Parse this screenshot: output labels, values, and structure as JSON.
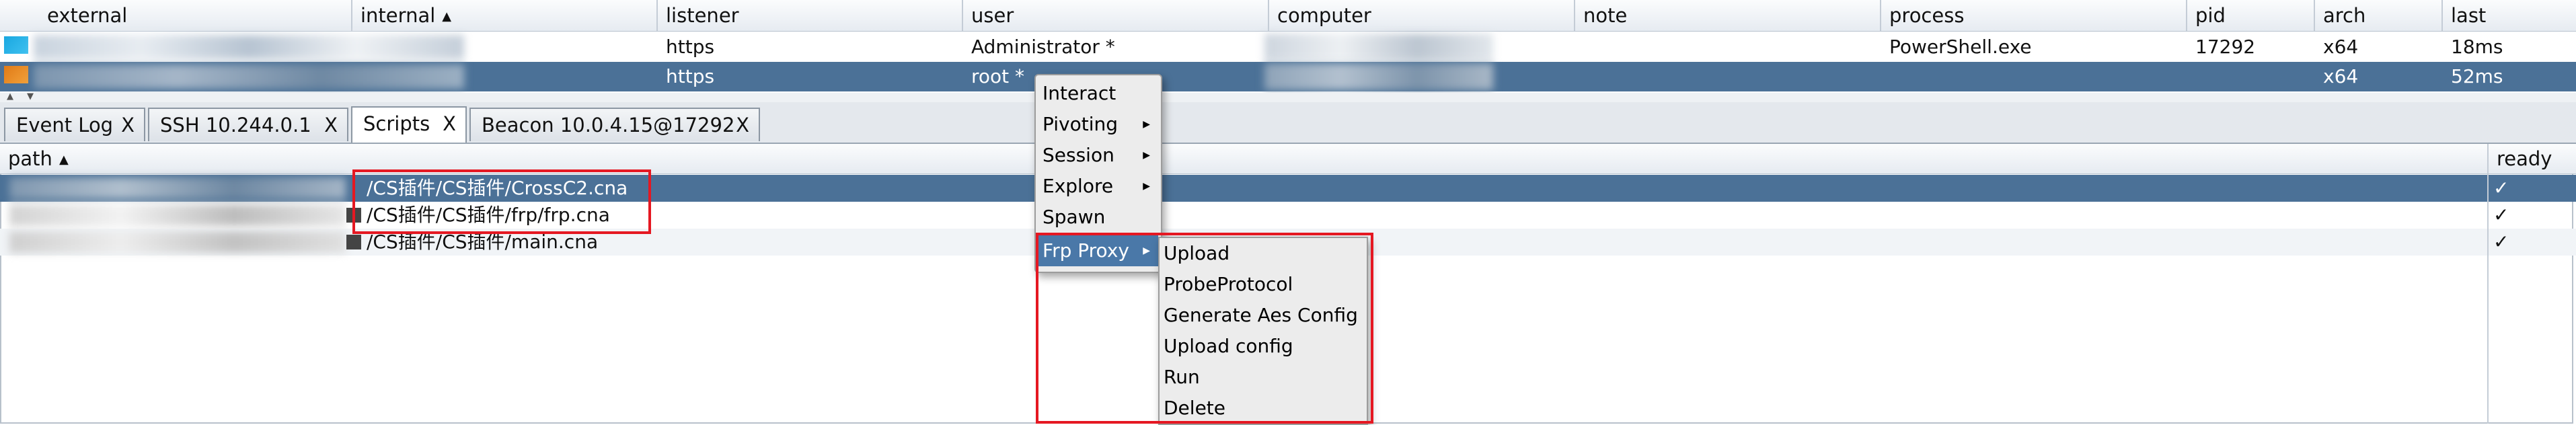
{
  "sessions": {
    "columns": [
      "external",
      "internal",
      "listener",
      "user",
      "computer",
      "note",
      "process",
      "pid",
      "arch",
      "last"
    ],
    "rows": [
      {
        "listener": "https",
        "user": "Administrator *",
        "process": "PowerShell.exe",
        "pid": "17292",
        "arch": "x64",
        "last": "18ms"
      },
      {
        "listener": "https",
        "user": "root *",
        "process": "",
        "pid": "",
        "arch": "x64",
        "last": "52ms"
      }
    ]
  },
  "tabs": [
    {
      "label": "Event Log",
      "close": "X"
    },
    {
      "label": "SSH 10.244.0.1",
      "close": "X"
    },
    {
      "label": "Scripts",
      "close": "X"
    },
    {
      "label": "Beacon 10.0.4.15@17292",
      "close": "X"
    }
  ],
  "scripts": {
    "columns": [
      "path",
      "ready"
    ],
    "rows": [
      {
        "path": "/CS插件/CS插件/CrossC2.cna",
        "ready": "✓"
      },
      {
        "path": "/CS插件/CS插件/frp/frp.cna",
        "ready": "✓"
      },
      {
        "path": "/CS插件/CS插件/main.cna",
        "ready": "✓"
      }
    ]
  },
  "context_menu": {
    "items": [
      "Interact",
      "Pivoting",
      "Session",
      "Explore",
      "Spawn",
      "Frp Proxy"
    ]
  },
  "submenu": {
    "items": [
      "Upload",
      "ProbeProtocol",
      "Generate Aes Config",
      "Upload config",
      "Run",
      "Delete"
    ]
  },
  "colors": {
    "selection": "#4b7197",
    "highlight": "#4a78a8",
    "annotation": "#e51822"
  }
}
